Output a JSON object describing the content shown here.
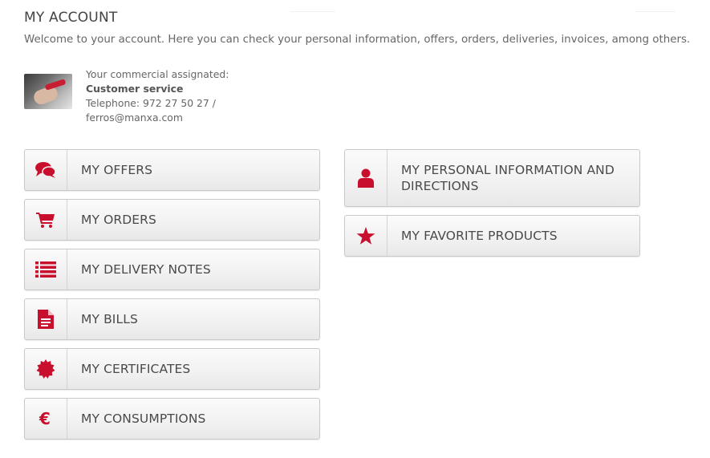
{
  "page": {
    "title": "MY ACCOUNT",
    "welcome": "Welcome to your account. Here you can check your personal information, offers, orders, deliveries, invoices, among others."
  },
  "commercial": {
    "heading": "Your commercial assignated:",
    "name": "Customer service",
    "telephone": "Telephone: 972 27 50 27 /",
    "email": "ferros@manxa.com"
  },
  "menu": {
    "left": [
      {
        "label": "MY OFFERS",
        "icon": "comments-icon"
      },
      {
        "label": "MY ORDERS",
        "icon": "shopping-cart-icon"
      },
      {
        "label": "MY DELIVERY NOTES",
        "icon": "list-icon"
      },
      {
        "label": "MY BILLS",
        "icon": "document-icon"
      },
      {
        "label": "MY CERTIFICATES",
        "icon": "certificate-icon"
      },
      {
        "label": "MY CONSUMPTIONS",
        "icon": "euro-icon"
      }
    ],
    "right": [
      {
        "label": "MY PERSONAL INFORMATION AND DIRECTIONS",
        "icon": "user-icon"
      },
      {
        "label": "MY FAVORITE PRODUCTS",
        "icon": "star-icon"
      }
    ]
  },
  "colors": {
    "accent": "#c8102e",
    "text": "#4a4a4a",
    "button_border": "#c9c9c9"
  }
}
